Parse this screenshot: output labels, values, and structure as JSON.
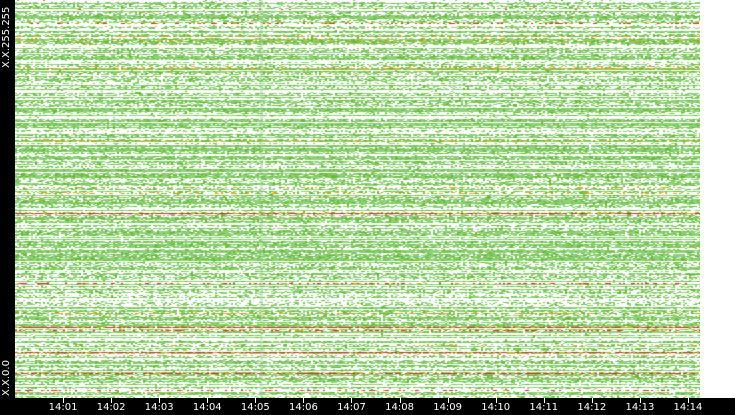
{
  "chart_data": {
    "type": "heatmap",
    "title": "",
    "xlabel": "",
    "ylabel": "",
    "y_labels": {
      "top": "X.X.255.255",
      "bottom": "X.X.0.0"
    },
    "x_ticks": [
      "14:01",
      "14:02",
      "14:03",
      "14:04",
      "14:05",
      "14:06",
      "14:07",
      "14:08",
      "14:09",
      "14:10",
      "14:11",
      "14:12",
      "14:13",
      "14:14"
    ],
    "x_range_minutes": [
      0.0,
      14.25
    ],
    "colors": {
      "low": "#8fd17a",
      "mid": "#66bb33",
      "high": "#f0a020",
      "max": "#ee2222",
      "background": "#ffffff",
      "axis": "#000000"
    }
  }
}
